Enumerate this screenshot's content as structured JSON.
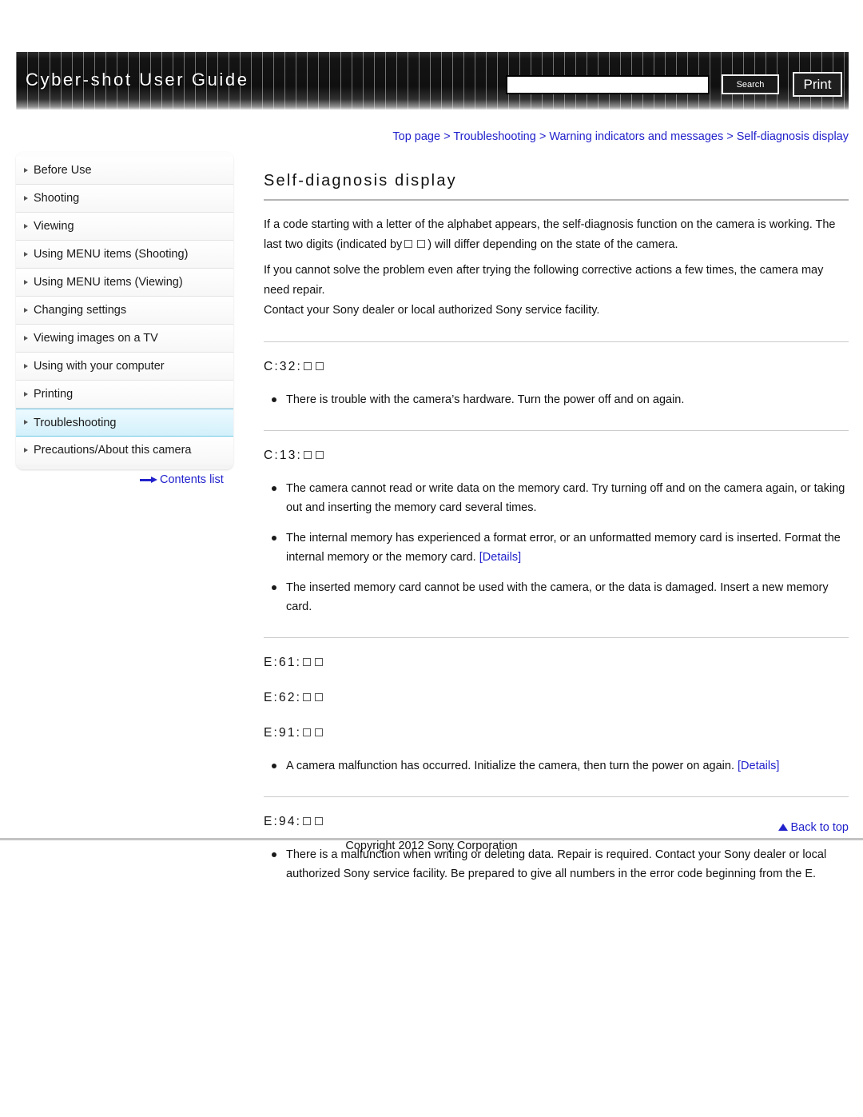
{
  "header": {
    "title": "Cyber-shot User Guide",
    "search_value": "",
    "search_placeholder": "",
    "search_label": "Search",
    "print_label": "Print"
  },
  "breadcrumb": {
    "items": [
      "Top page",
      "Troubleshooting",
      "Warning indicators and messages",
      "Self-diagnosis display"
    ],
    "separator": ">"
  },
  "sidebar": {
    "items": [
      {
        "label": "Before Use",
        "active": false
      },
      {
        "label": "Shooting",
        "active": false
      },
      {
        "label": "Viewing",
        "active": false
      },
      {
        "label": "Using MENU items (Shooting)",
        "active": false
      },
      {
        "label": "Using MENU items (Viewing)",
        "active": false
      },
      {
        "label": "Changing settings",
        "active": false
      },
      {
        "label": "Viewing images on a TV",
        "active": false
      },
      {
        "label": "Using with your computer",
        "active": false
      },
      {
        "label": "Printing",
        "active": false
      },
      {
        "label": "Troubleshooting",
        "active": true
      },
      {
        "label": "Precautions/About this camera",
        "active": false
      }
    ],
    "contents_link": "Contents list"
  },
  "main": {
    "page_title": "Self-diagnosis display",
    "intro": {
      "p1_a": "If a code starting with a letter of the alphabet appears, the self-diagnosis function on the camera is working. The last two digits (indicated by",
      "p1_b": ") will differ depending on the state of the camera.",
      "p2": "If you cannot solve the problem even after trying the following corrective actions a few times, the camera may need repair.",
      "p3": "Contact your Sony dealer or local authorized Sony service facility."
    },
    "sections": [
      {
        "codes": [
          "C:32:"
        ],
        "bullets": [
          {
            "text": "There is trouble with the camera’s hardware. Turn the power off and on again.",
            "link": ""
          }
        ]
      },
      {
        "codes": [
          "C:13:"
        ],
        "bullets": [
          {
            "text": "The camera cannot read or write data on the memory card. Try turning off and on the camera again, or taking out and inserting the memory card several times.",
            "link": ""
          },
          {
            "text": "The internal memory has experienced a format error, or an unformatted memory card is inserted. Format the internal memory or the memory card.",
            "link": "[Details]"
          },
          {
            "text": "The inserted memory card cannot be used with the camera, or the data is damaged. Insert a new memory card.",
            "link": ""
          }
        ]
      },
      {
        "codes": [
          "E:61:",
          "E:62:",
          "E:91:"
        ],
        "bullets": [
          {
            "text": "A camera malfunction has occurred. Initialize the camera, then turn the power on again.",
            "link": "[Details]"
          }
        ]
      },
      {
        "codes": [
          "E:94:"
        ],
        "bullets": [
          {
            "text": "There is a malfunction when writing or deleting data. Repair is required. Contact your Sony dealer or local authorized Sony service facility. Be prepared to give all numbers in the error code beginning from the E.",
            "link": ""
          }
        ]
      }
    ]
  },
  "footer": {
    "back_to_top": "Back to top",
    "copyright": "Copyright 2012 Sony Corporation"
  },
  "colors": {
    "link": "#2222cc",
    "accent_highlight": "#d3f0fb",
    "header_bg": "#101010"
  }
}
